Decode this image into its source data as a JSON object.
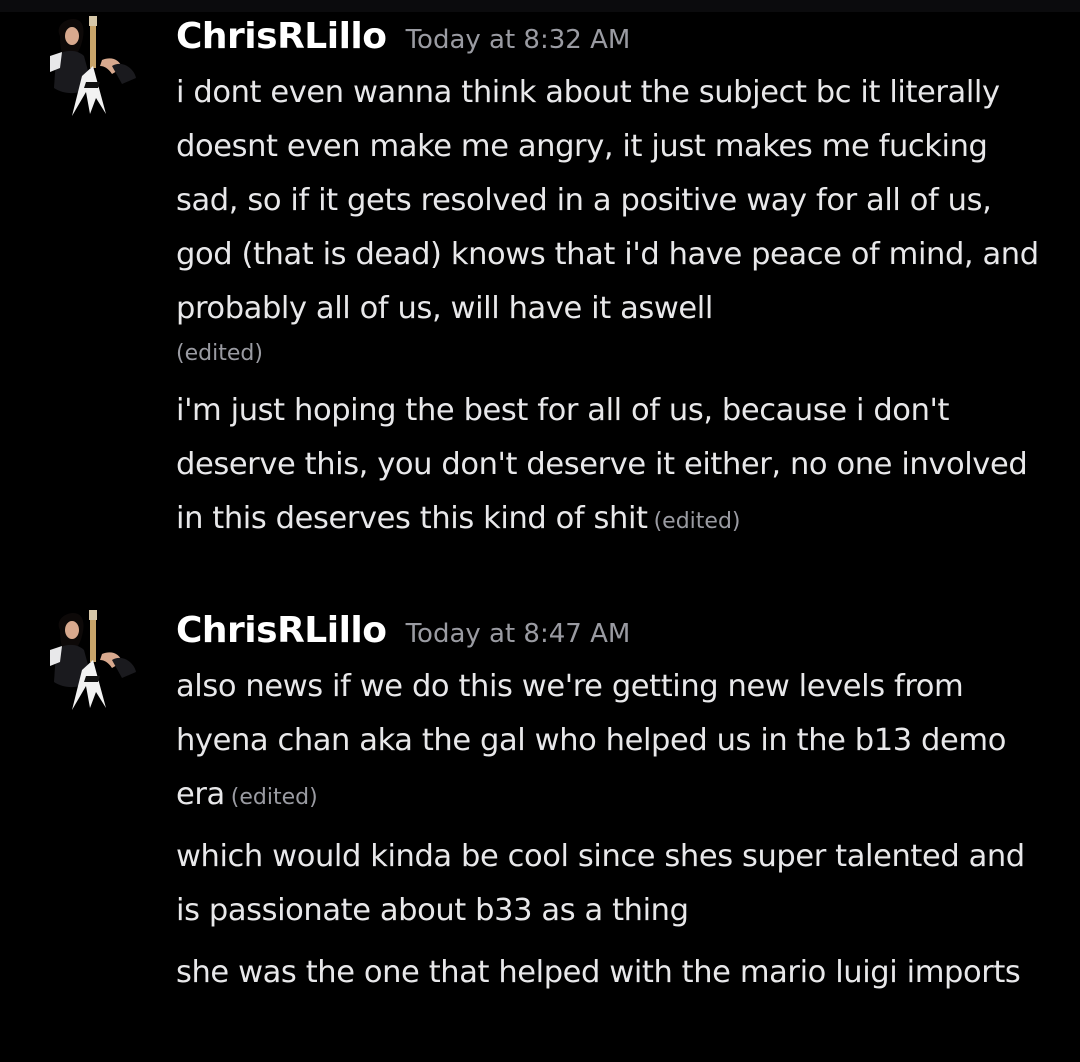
{
  "groups": [
    {
      "username": "ChrisRLillo",
      "timestamp": "Today at 8:32 AM",
      "messages": [
        {
          "text": "i dont even wanna think about the subject bc it literally doesnt even make me angry, it just makes me fucking sad, so if it gets resolved in a positive way for all of us, god (that is dead) knows that i'd have peace of mind, and probably all of us, will have it aswell",
          "edited": "(edited)"
        },
        {
          "text": "i'm just hoping the best for all of us, because i don't deserve this, you don't deserve it either, no one involved in this deserves this kind of shit",
          "edited": "(edited)"
        }
      ]
    },
    {
      "username": "ChrisRLillo",
      "timestamp": "Today at 8:47 AM",
      "messages": [
        {
          "text": "also news if we do this we're getting new levels from hyena chan aka the gal who helped us in the b13 demo era",
          "edited": "(edited)"
        },
        {
          "text": "which would kinda be cool since shes super talented and is passionate about b33 as a thing"
        },
        {
          "text": "she was the one that helped with the mario luigi imports"
        }
      ]
    }
  ],
  "colors": {
    "background": "#000000",
    "username": "#ffffff",
    "message_text": "#e8e8ea",
    "muted": "#9a9ba2"
  },
  "icons": {
    "avatar": "guitarist-avatar-icon"
  }
}
